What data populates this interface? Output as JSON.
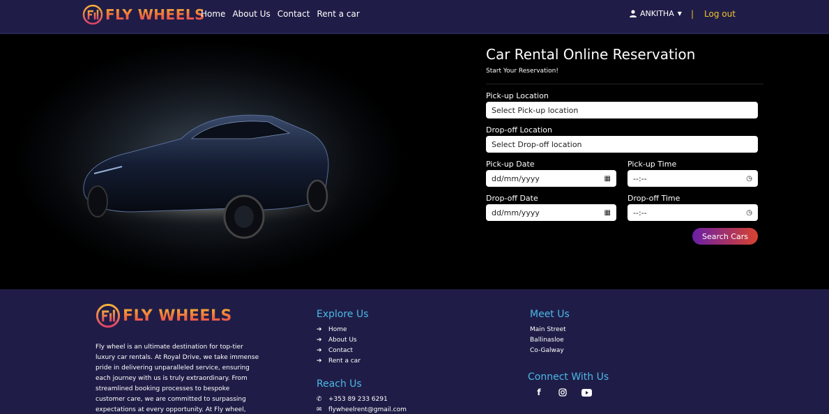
{
  "brand": {
    "name": "FLY WHEELS"
  },
  "nav": {
    "links": [
      "Home",
      "About Us",
      "Contact",
      "Rent a car"
    ],
    "user": "ANKITHA",
    "separator": "|",
    "logout": "Log out"
  },
  "reservation": {
    "title": "Car Rental Online Reservation",
    "subtitle": "Start Your Reservation!",
    "pickup_location_label": "Pick-up Location",
    "pickup_location_value": "Select Pick-up location",
    "dropoff_location_label": "Drop-off Location",
    "dropoff_location_value": "Select Drop-off location",
    "pickup_date_label": "Pick-up Date",
    "pickup_date_value": "dd/mm/yyyy",
    "pickup_time_label": "Pick-up Time",
    "pickup_time_value": "--:--",
    "dropoff_date_label": "Drop-off Date",
    "dropoff_date_value": "dd/mm/yyyy",
    "dropoff_time_label": "Drop-off Time",
    "dropoff_time_value": "--:--",
    "search_button": "Search Cars"
  },
  "footer": {
    "description": "Fly wheel is an ultimate destination for top-tier luxury car rentals. At Royal Drive, we take immense pride in delivering unparalleled service, ensuring each journey with us is truly extraordinary. From streamlined booking processes to bespoke customer care, we are committed to surpassing expectations at every opportunity. At Fly wheel,",
    "explore_heading": "Explore Us",
    "explore_links": [
      "Home",
      "About Us",
      "Contact",
      "Rent a car"
    ],
    "reach_heading": "Reach Us",
    "phone": "+353 89 233 6291",
    "email": "flywheelrent@gmail.com",
    "meet_heading": "Meet Us",
    "address": [
      "Main Street",
      "Ballinasloe",
      "Co-Galway"
    ],
    "connect_heading": "Connect With Us",
    "social_icons": [
      "facebook-icon",
      "instagram-icon",
      "youtube-icon"
    ]
  },
  "colors": {
    "navy": "#1f1d47",
    "accent_yellow": "#f4c430",
    "heading_blue": "#4db8e8",
    "button_gradient_start": "#6a1fa8",
    "button_gradient_end": "#d8432e"
  }
}
